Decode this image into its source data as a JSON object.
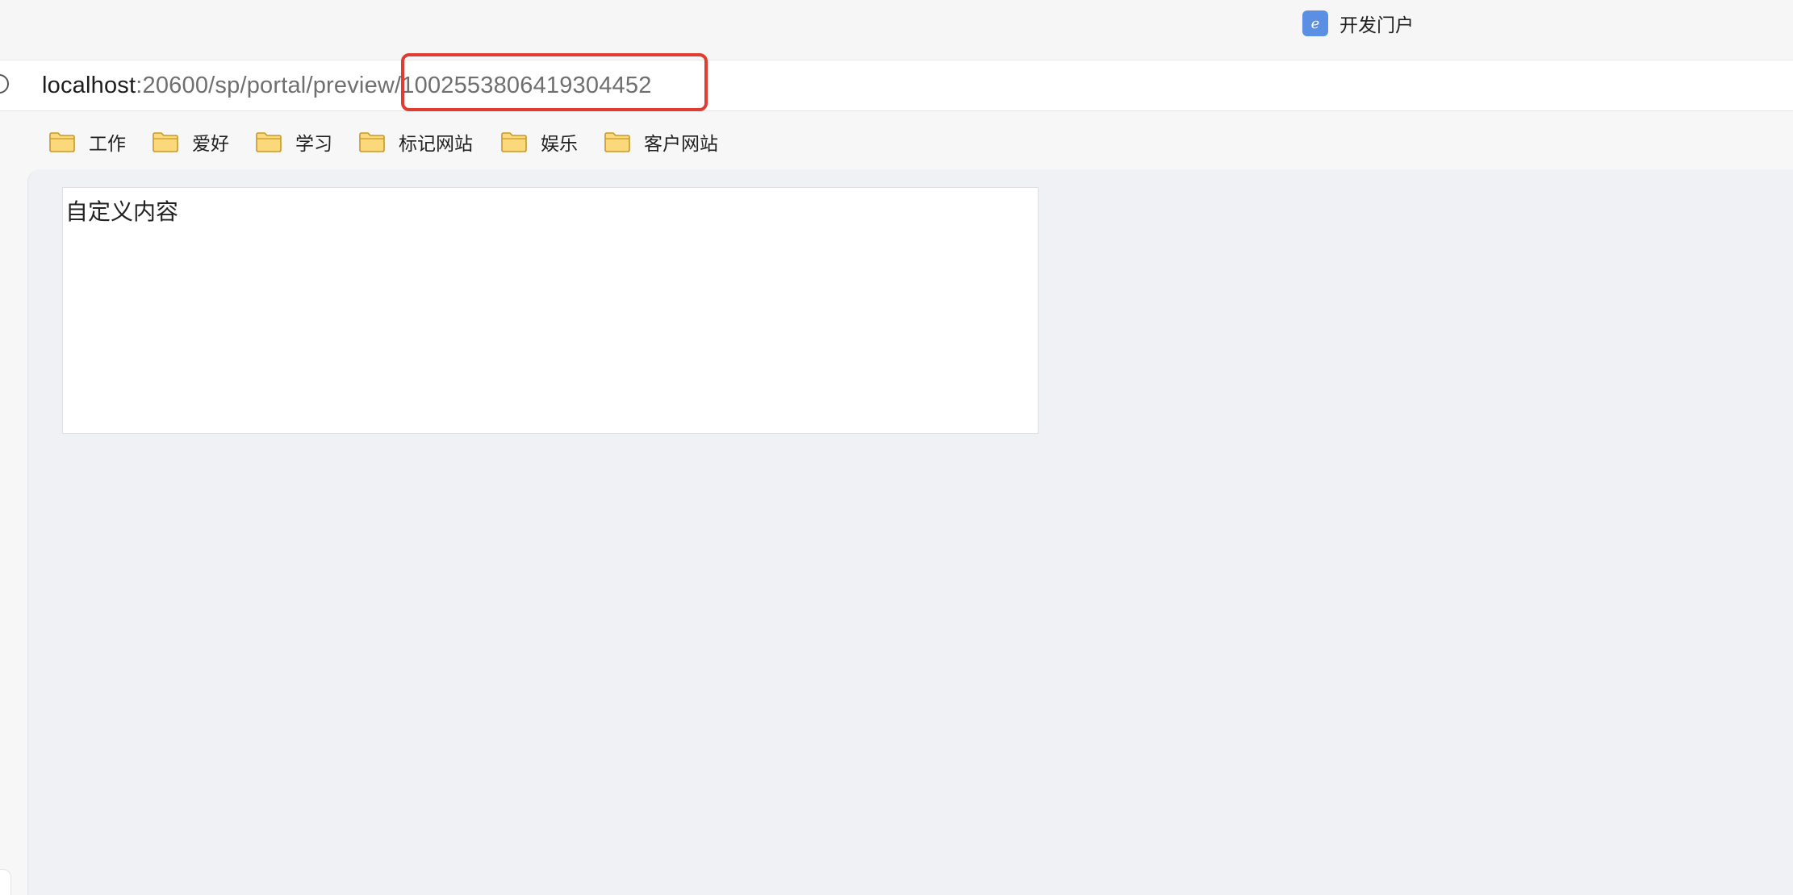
{
  "tab": {
    "title": "开发门户",
    "favicon_icon": "e-logo-icon",
    "favicon_letter": "e",
    "favicon_color": "#5b8fe3"
  },
  "address_bar": {
    "info_icon": "info-icon",
    "url_host": "localhost",
    "url_path": ":20600/sp/portal/preview/1002553806419304452",
    "highlight_color": "#e03c31"
  },
  "bookmarks": {
    "folder_icon": "folder-icon",
    "items": [
      {
        "label": "工作"
      },
      {
        "label": "爱好"
      },
      {
        "label": "学习"
      },
      {
        "label": "标记网站"
      },
      {
        "label": "娱乐"
      },
      {
        "label": "客户网站"
      }
    ]
  },
  "page": {
    "background_color": "#eff1f5",
    "card_text": "自定义内容"
  }
}
